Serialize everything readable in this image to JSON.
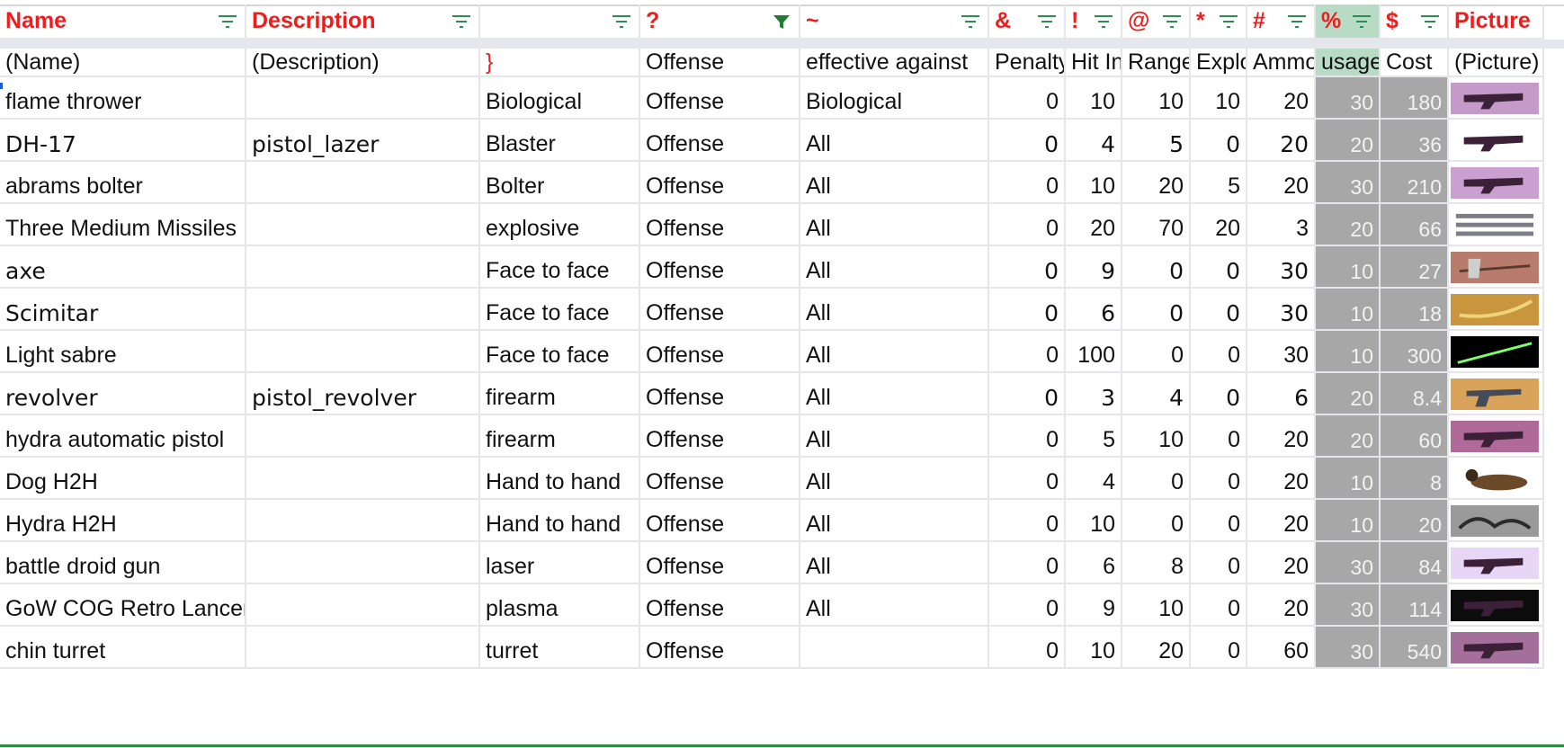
{
  "headers": [
    {
      "label": "Name",
      "filter": "sort"
    },
    {
      "label": "Description",
      "filter": "sort"
    },
    {
      "label": "",
      "filter": "sort"
    },
    {
      "label": "?",
      "filter": "active"
    },
    {
      "label": "~",
      "filter": "sort"
    },
    {
      "label": "&",
      "filter": "sort"
    },
    {
      "label": "!",
      "filter": "sort"
    },
    {
      "label": "@",
      "filter": "sort"
    },
    {
      "label": "*",
      "filter": "sort"
    },
    {
      "label": "#",
      "filter": "sort"
    },
    {
      "label": "%",
      "filter": "sort"
    },
    {
      "label": "$",
      "filter": "sort"
    },
    {
      "label": "Picture",
      "filter": "none"
    }
  ],
  "subheaders": [
    "(Name)",
    "(Description)",
    "}",
    "Offense",
    "effective against",
    "Penalty",
    "Hit In",
    "Range",
    "Explo",
    "Ammo",
    "usage",
    "Cost",
    "(Picture)"
  ],
  "rows": [
    {
      "name": "flame thrower",
      "desc": "",
      "type": "Biological",
      "mode": "Offense",
      "eff": "Biological",
      "pen": "0",
      "hit": "10",
      "range": "10",
      "expl": "10",
      "ammo": "20",
      "usage": "30",
      "cost": "180",
      "picture": "flamethrower-thumbnail"
    },
    {
      "name": "DH-17",
      "desc": "pistol_lazer",
      "type": "Blaster",
      "mode": "Offense",
      "eff": "All",
      "pen": "0",
      "hit": "4",
      "range": "5",
      "expl": "0",
      "ammo": "20",
      "usage": "20",
      "cost": "36",
      "picture": "blaster-pistol-thumbnail"
    },
    {
      "name": "abrams bolter",
      "desc": "",
      "type": "Bolter",
      "mode": "Offense",
      "eff": "All",
      "pen": "0",
      "hit": "10",
      "range": "20",
      "expl": "5",
      "ammo": "20",
      "usage": "30",
      "cost": "210",
      "picture": "bolter-thumbnail"
    },
    {
      "name": "Three Medium Missiles",
      "desc": "",
      "type": "explosive",
      "mode": "Offense",
      "eff": "All",
      "pen": "0",
      "hit": "20",
      "range": "70",
      "expl": "20",
      "ammo": "3",
      "usage": "20",
      "cost": "66",
      "picture": "missiles-thumbnail"
    },
    {
      "name": "axe",
      "desc": "",
      "type": "Face to face",
      "mode": "Offense",
      "eff": "All",
      "pen": "0",
      "hit": "9",
      "range": "0",
      "expl": "0",
      "ammo": "30",
      "usage": "10",
      "cost": "27",
      "picture": "axe-thumbnail"
    },
    {
      "name": "Scimitar",
      "desc": "",
      "type": "Face to face",
      "mode": "Offense",
      "eff": "All",
      "pen": "0",
      "hit": "6",
      "range": "0",
      "expl": "0",
      "ammo": "30",
      "usage": "10",
      "cost": "18",
      "picture": "scimitar-thumbnail"
    },
    {
      "name": "Light sabre",
      "desc": "",
      "type": "Face to face",
      "mode": "Offense",
      "eff": "All",
      "pen": "0",
      "hit": "100",
      "range": "0",
      "expl": "0",
      "ammo": "30",
      "usage": "10",
      "cost": "300",
      "picture": "lightsaber-thumbnail"
    },
    {
      "name": "revolver",
      "desc": "pistol_revolver",
      "type": "firearm",
      "mode": "Offense",
      "eff": "All",
      "pen": "0",
      "hit": "3",
      "range": "4",
      "expl": "0",
      "ammo": "6",
      "usage": "20",
      "cost": "8.4",
      "picture": "revolver-thumbnail"
    },
    {
      "name": "hydra automatic pistol",
      "desc": "",
      "type": "firearm",
      "mode": "Offense",
      "eff": "All",
      "pen": "0",
      "hit": "5",
      "range": "10",
      "expl": "0",
      "ammo": "20",
      "usage": "20",
      "cost": "60",
      "picture": "pistol-thumbnail"
    },
    {
      "name": "Dog H2H",
      "desc": "",
      "type": "Hand to hand",
      "mode": "Offense",
      "eff": "All",
      "pen": "0",
      "hit": "4",
      "range": "0",
      "expl": "0",
      "ammo": "20",
      "usage": "10",
      "cost": "8",
      "picture": "dog-thumbnail"
    },
    {
      "name": "Hydra H2H",
      "desc": "",
      "type": "Hand to hand",
      "mode": "Offense",
      "eff": "All",
      "pen": "0",
      "hit": "10",
      "range": "0",
      "expl": "0",
      "ammo": "20",
      "usage": "10",
      "cost": "20",
      "picture": "hydra-thumbnail"
    },
    {
      "name": "battle droid gun",
      "desc": "",
      "type": "laser",
      "mode": "Offense",
      "eff": "All",
      "pen": "0",
      "hit": "6",
      "range": "8",
      "expl": "0",
      "ammo": "20",
      "usage": "30",
      "cost": "84",
      "picture": "droid-gun-thumbnail"
    },
    {
      "name": "GoW COG Retro Lancer",
      "desc": "",
      "type": "plasma",
      "mode": "Offense",
      "eff": "All",
      "pen": "0",
      "hit": "9",
      "range": "10",
      "expl": "0",
      "ammo": "20",
      "usage": "30",
      "cost": "114",
      "picture": "lancer-thumbnail"
    },
    {
      "name": "chin turret",
      "desc": "",
      "type": "turret",
      "mode": "Offense",
      "eff": "",
      "pen": "0",
      "hit": "10",
      "range": "20",
      "expl": "0",
      "ammo": "60",
      "usage": "30",
      "cost": "540",
      "picture": "turret-thumbnail"
    }
  ],
  "colors": {
    "header_text": "#ee1c1c",
    "filter_icon": "#2e8b57",
    "active_filter": "#1e7d32",
    "grey_col": "#a7a7a7",
    "usage_header": "#b8dbc6"
  }
}
